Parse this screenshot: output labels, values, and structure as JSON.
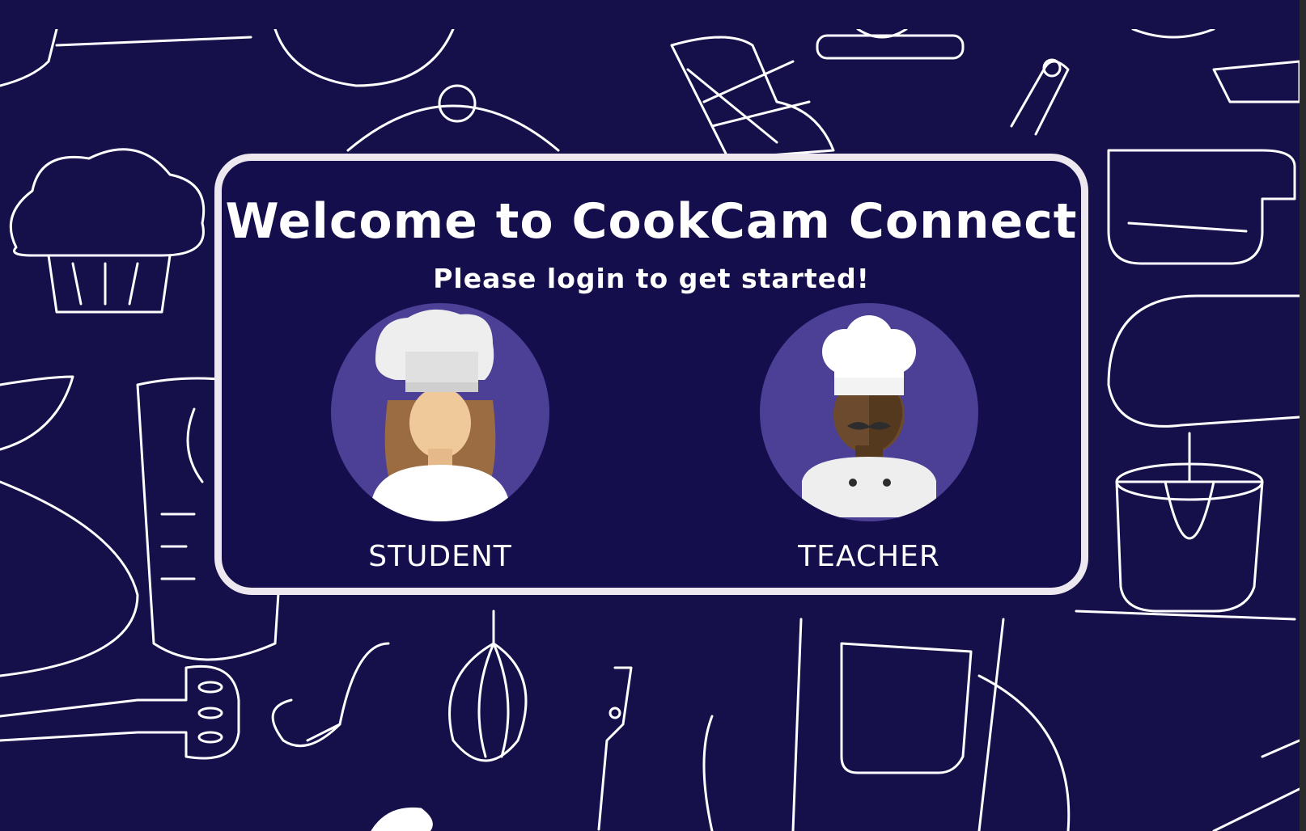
{
  "login": {
    "title": "Welcome to CookCam Connect",
    "subtitle": "Please login to get started!",
    "roles": [
      {
        "label": "STUDENT",
        "icon": "female-chef-avatar-icon"
      },
      {
        "label": "TEACHER",
        "icon": "male-chef-avatar-icon"
      }
    ]
  },
  "colors": {
    "background": "#15104a",
    "card_background": "#150e4d",
    "card_border": "#ede7f0",
    "avatar_circle": "#4b3f96",
    "doodle_line": "#ffffff"
  }
}
